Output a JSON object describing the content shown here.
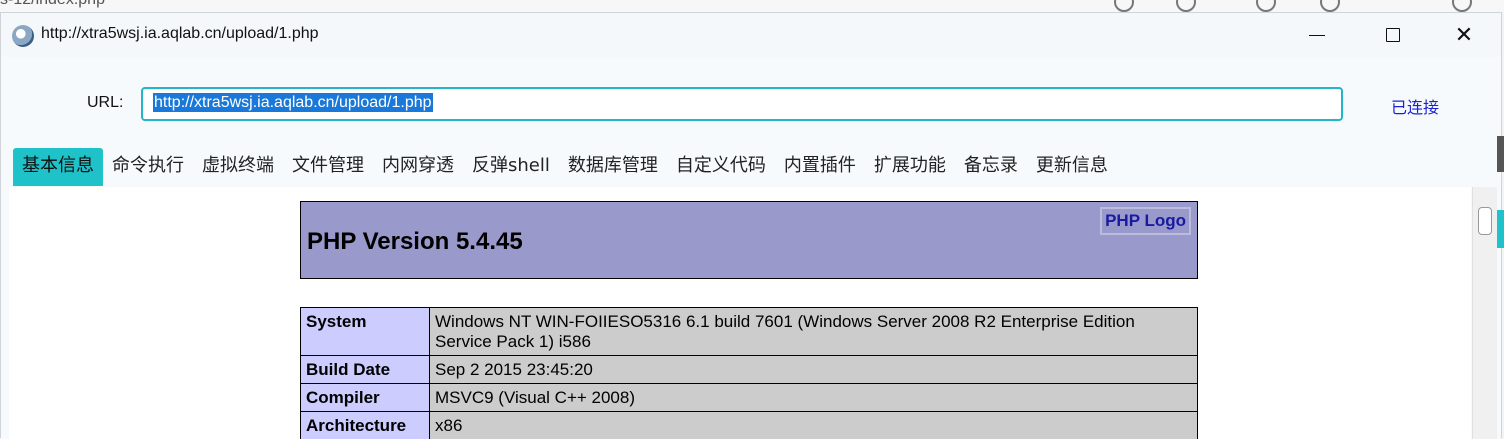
{
  "background": {
    "text": "s-12/index.php"
  },
  "window": {
    "title": "http://xtra5wsj.ia.aqlab.cn/upload/1.php",
    "close_glyph": "✕"
  },
  "connection": {
    "url_label": "URL:",
    "url_value": "http://xtra5wsj.ia.aqlab.cn/upload/1.php",
    "status": "已连接"
  },
  "tabs": [
    {
      "label": "基本信息",
      "active": true
    },
    {
      "label": "命令执行"
    },
    {
      "label": "虚拟终端"
    },
    {
      "label": "文件管理"
    },
    {
      "label": "内网穿透"
    },
    {
      "label": "反弹shell"
    },
    {
      "label": "数据库管理"
    },
    {
      "label": "自定义代码"
    },
    {
      "label": "内置插件"
    },
    {
      "label": "扩展功能"
    },
    {
      "label": "备忘录"
    },
    {
      "label": "更新信息"
    }
  ],
  "phpinfo": {
    "title": "PHP Version 5.4.45",
    "logo_alt": "PHP Logo",
    "rows": [
      {
        "key": "System",
        "value": "Windows NT WIN-FOIIESO5316 6.1 build 7601 (Windows Server 2008 R2 Enterprise Edition Service Pack 1) i586"
      },
      {
        "key": "Build Date",
        "value": "Sep 2 2015 23:45:20"
      },
      {
        "key": "Compiler",
        "value": "MSVC9 (Visual C++ 2008)"
      },
      {
        "key": "Architecture",
        "value": "x86"
      }
    ]
  },
  "colors": {
    "accent": "#1fc2c8",
    "status": "#1a22d6",
    "php_header": "#9999cc"
  }
}
